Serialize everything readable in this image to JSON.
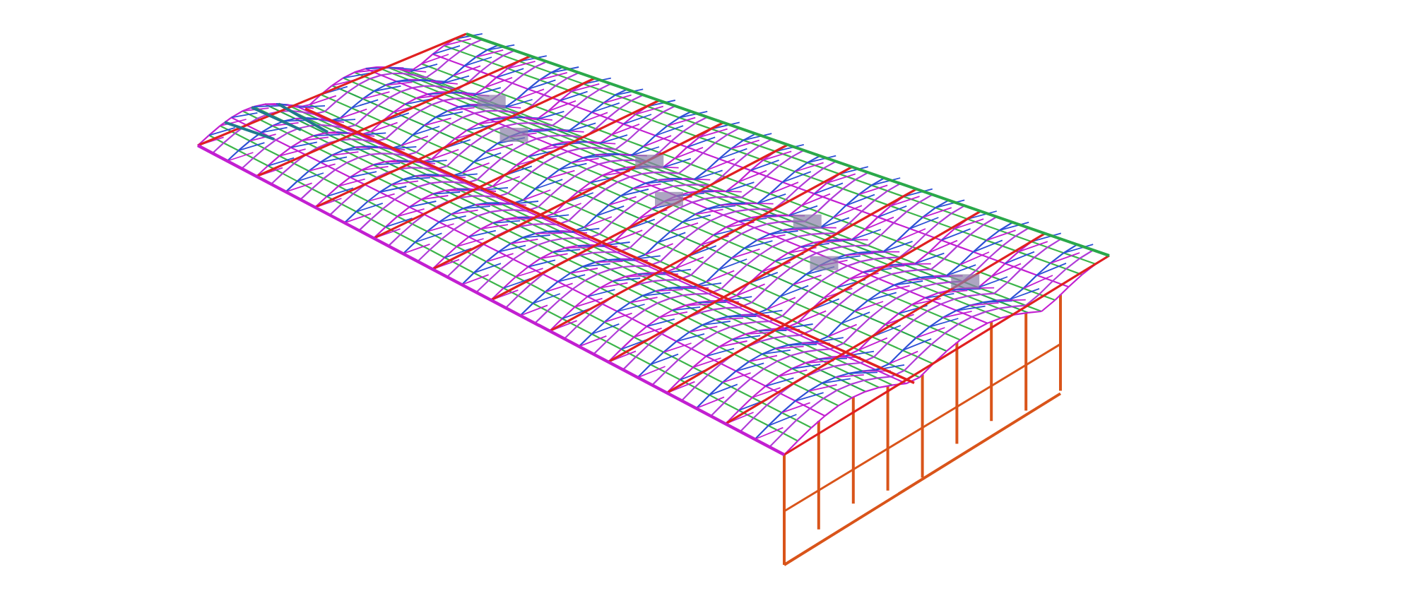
{
  "view": {
    "kind": "wireframe"
  }
}
